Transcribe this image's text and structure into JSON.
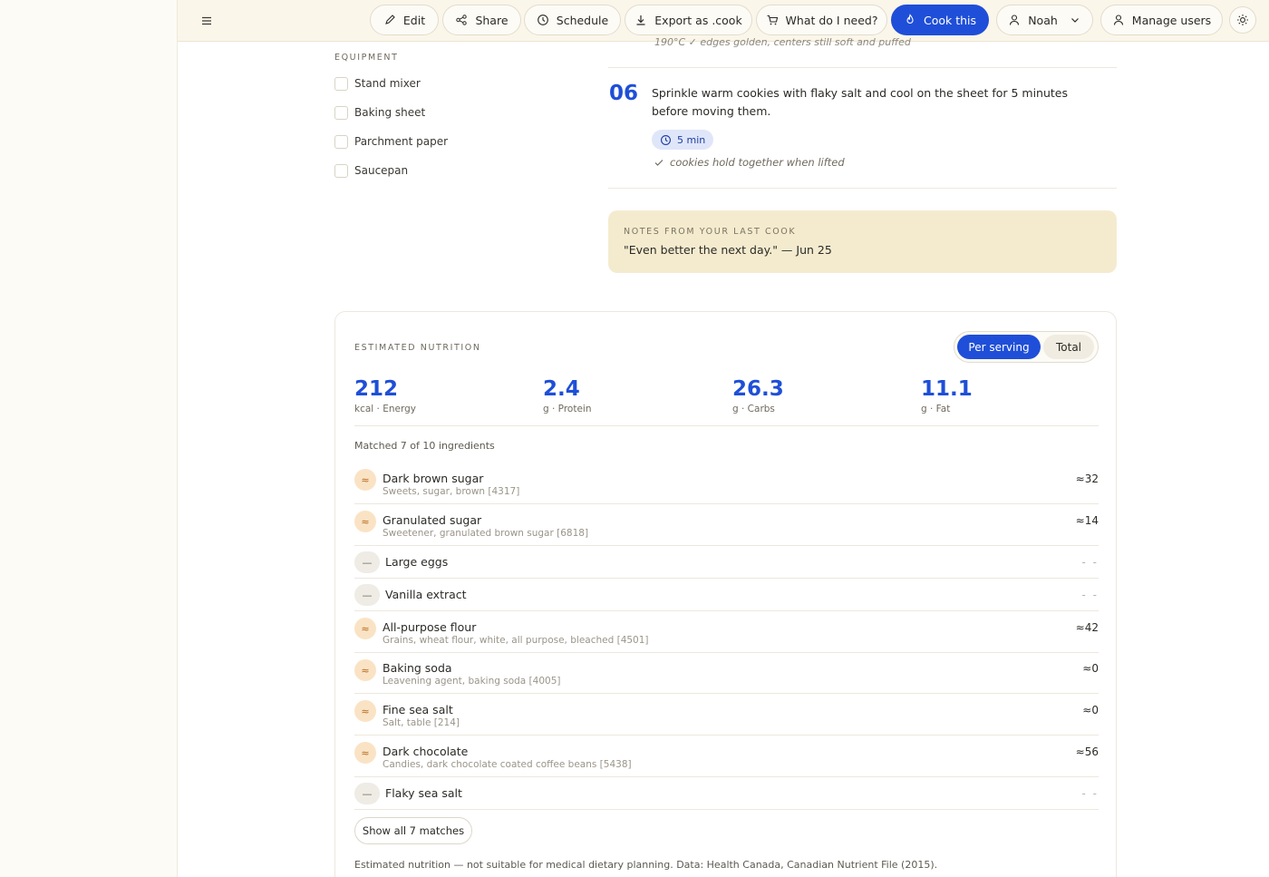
{
  "toolbar": {
    "edit": "Edit",
    "share": "Share",
    "schedule": "Schedule",
    "export": "Export as .cook",
    "what_need": "What do I need?",
    "cook_this": "Cook this",
    "user": "Noah",
    "manage_users": "Manage users"
  },
  "equipment": {
    "title": "EQUIPMENT",
    "items": [
      "Stand mixer",
      "Baking sheet",
      "Parchment paper",
      "Saucepan"
    ]
  },
  "steps": {
    "prev_partial": "190°C ✓  edges golden, centers still soft and puffed",
    "current": {
      "number": "06",
      "text": "Sprinkle warm cookies with flaky salt and cool on the sheet for 5 minutes before moving them.",
      "timer": "5 min",
      "check": "cookies hold together when lifted"
    }
  },
  "notes": {
    "title": "NOTES FROM YOUR LAST COOK",
    "text": "\"Even better the next day.\" — Jun 25"
  },
  "nutrition": {
    "title": "ESTIMATED NUTRITION",
    "toggle": {
      "per_serving": "Per serving",
      "total": "Total",
      "selected": "Per serving"
    },
    "macros": [
      {
        "value": "212",
        "label": "kcal · Energy"
      },
      {
        "value": "2.4",
        "label": "g · Protein"
      },
      {
        "value": "26.3",
        "label": "g · Carbs"
      },
      {
        "value": "11.1",
        "label": "g · Fat"
      }
    ],
    "matched": "Matched 7 of 10 ingredients",
    "ingredients": [
      {
        "name": "Dark brown sugar",
        "sub": "Sweets, sugar, brown [4317]",
        "value": "≈32",
        "matched": true
      },
      {
        "name": "Granulated sugar",
        "sub": "Sweetener, granulated brown sugar [6818]",
        "value": "≈14",
        "matched": true
      },
      {
        "name": "Large eggs",
        "sub": "",
        "value": "- -",
        "matched": false
      },
      {
        "name": "Vanilla extract",
        "sub": "",
        "value": "- -",
        "matched": false
      },
      {
        "name": "All-purpose flour",
        "sub": "Grains, wheat flour, white, all purpose, bleached [4501]",
        "value": "≈42",
        "matched": true
      },
      {
        "name": "Baking soda",
        "sub": "Leavening agent, baking soda [4005]",
        "value": "≈0",
        "matched": true
      },
      {
        "name": "Fine sea salt",
        "sub": "Salt, table [214]",
        "value": "≈0",
        "matched": true
      },
      {
        "name": "Dark chocolate",
        "sub": "Candies, dark chocolate coated coffee beans [5438]",
        "value": "≈56",
        "matched": true
      },
      {
        "name": "Flaky sea salt",
        "sub": "",
        "value": "- -",
        "matched": false
      }
    ],
    "show_all": "Show all 7 matches",
    "disclaimer": "Estimated nutrition — not suitable for medical dietary planning. Data: Health Canada, Canadian Nutrient File (2015)."
  },
  "icons": {
    "menu": "menu-icon",
    "edit": "pencil-icon",
    "share": "share-icon",
    "schedule": "clock-icon",
    "export": "download-icon",
    "cart": "cart-icon",
    "flame": "flame-icon",
    "user": "user-icon",
    "chevron": "chevron-down-icon",
    "theme": "sun-icon",
    "timer": "clock-icon",
    "check": "check-icon",
    "match": "approx-icon",
    "nomatch": "dash-icon"
  },
  "colors": {
    "accent": "#1f4fd8",
    "topbar_bg": "#fbf6ea",
    "notes_bg": "#f4ebcf",
    "match_badge_bg": "#fae3c4"
  }
}
